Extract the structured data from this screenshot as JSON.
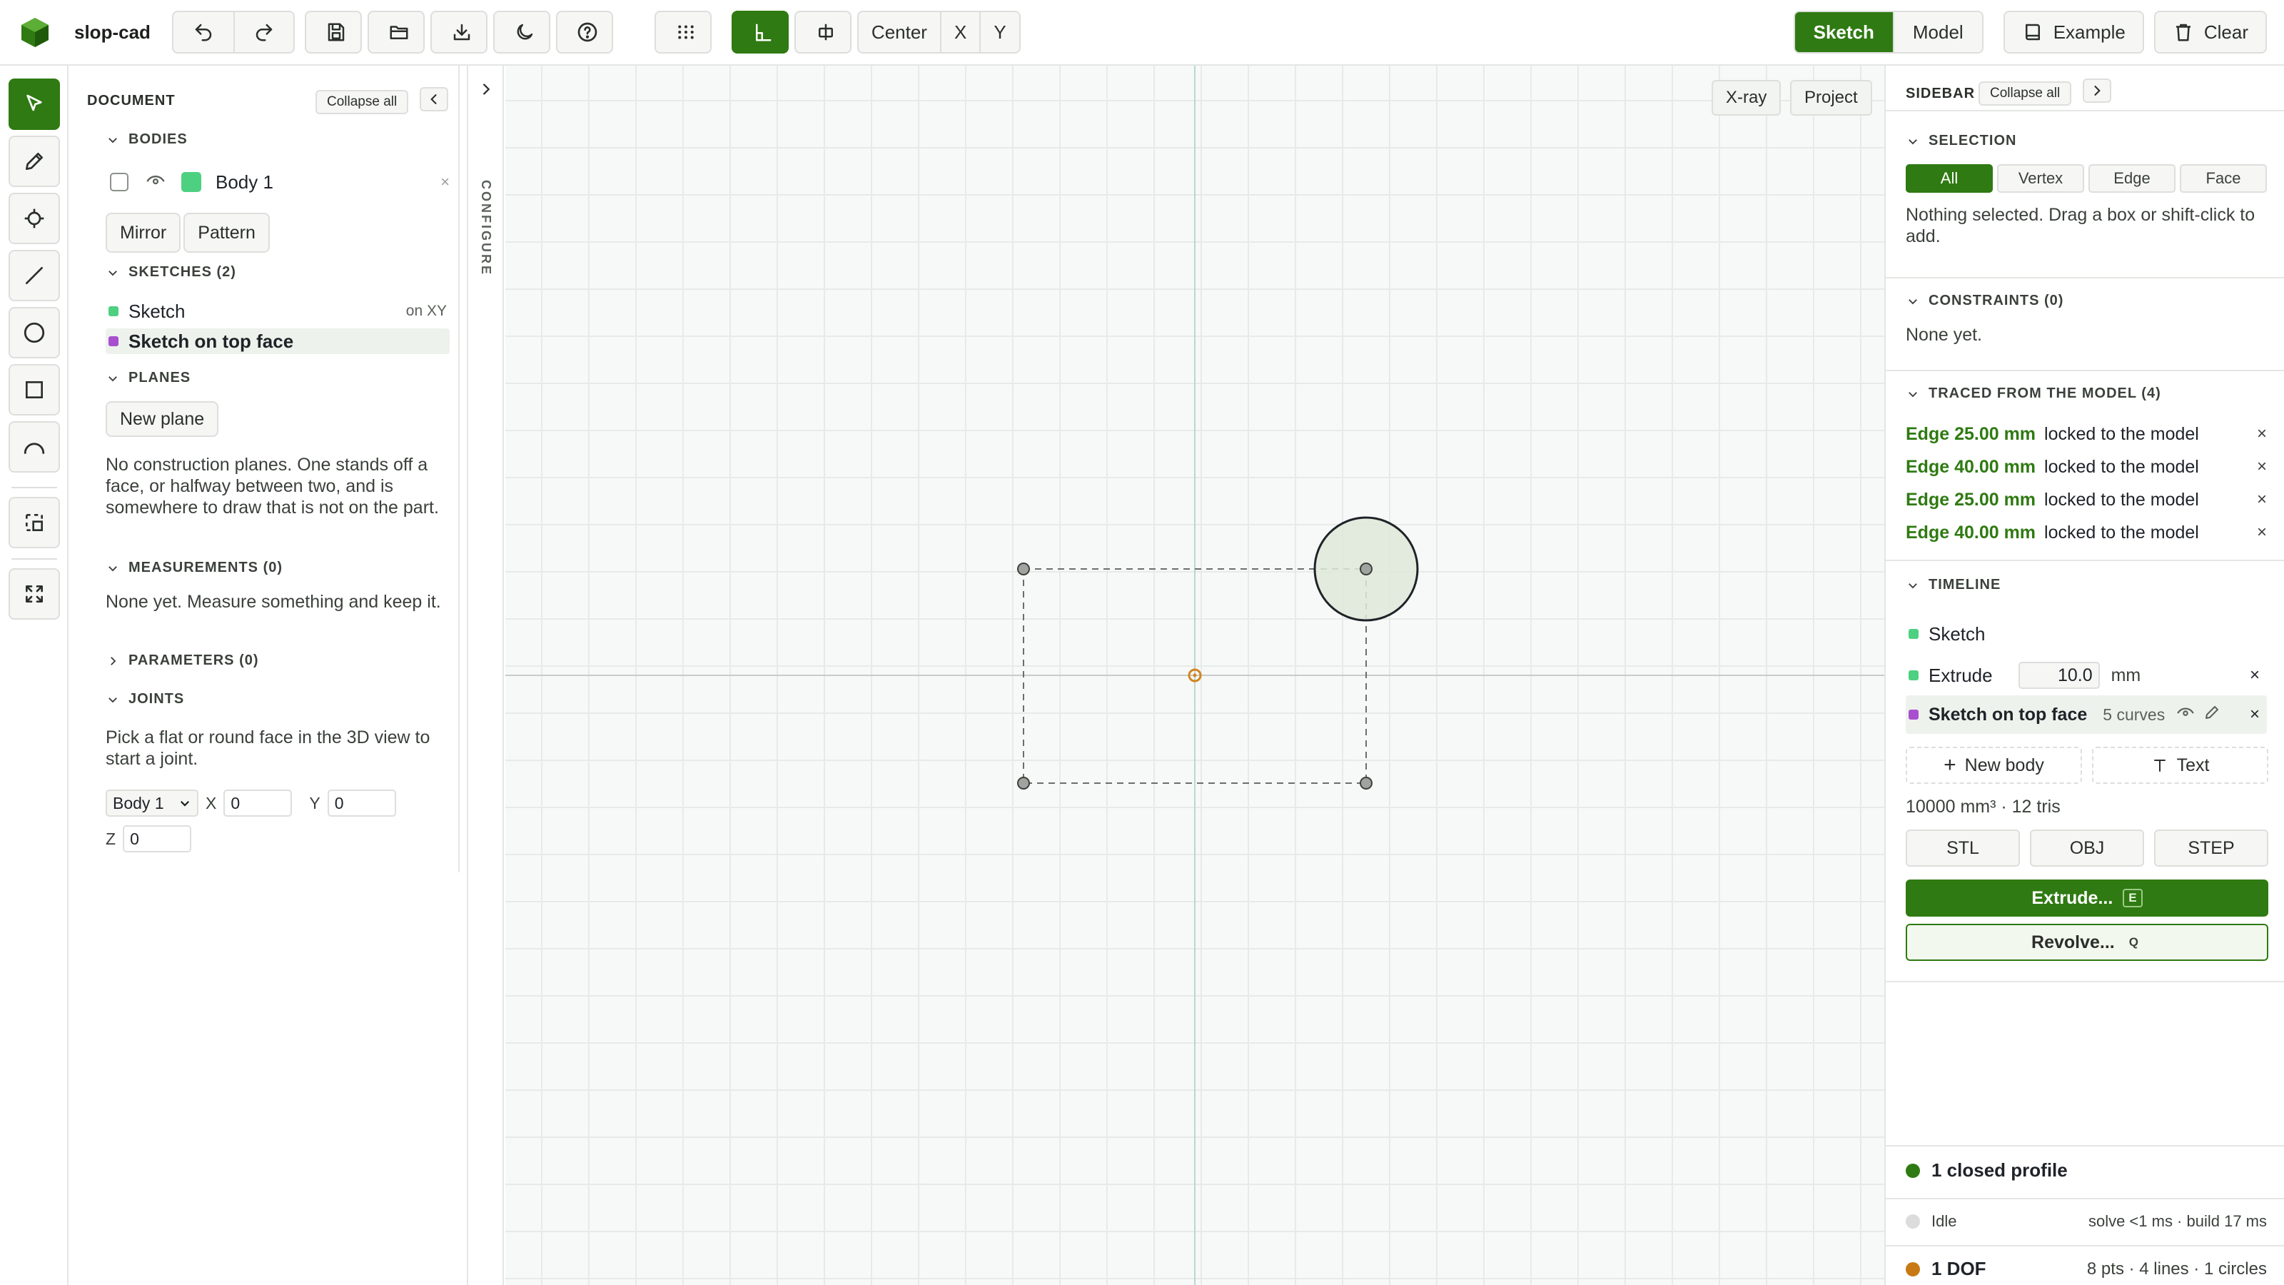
{
  "app": {
    "name": "slop-cad"
  },
  "toolbar": {
    "center_label": "Center",
    "x_label": "X",
    "y_label": "Y",
    "sketch_label": "Sketch",
    "model_label": "Model",
    "example_label": "Example",
    "clear_label": "Clear"
  },
  "document": {
    "title": "DOCUMENT",
    "collapse_all": "Collapse all",
    "bodies_header": "BODIES",
    "bodies": [
      {
        "name": "Body 1",
        "color": "#4ed081"
      }
    ],
    "mirror_label": "Mirror",
    "pattern_label": "Pattern",
    "sketches_header": "SKETCHES (2)",
    "sketches": [
      {
        "name": "Sketch",
        "plane": "on XY",
        "color": "#4ed081"
      },
      {
        "name": "Sketch on top face",
        "plane": "",
        "color": "#a84fd0"
      }
    ],
    "planes_header": "PLANES",
    "new_plane_label": "New plane",
    "planes_text": "No construction planes. One stands off a face, or halfway between two, and is somewhere to draw that is not on the part.",
    "measurements_header": "MEASUREMENTS (0)",
    "measurements_text": "None yet. Measure something and keep it.",
    "parameters_header": "PARAMETERS (0)",
    "joints_header": "JOINTS",
    "joints_text": "Pick a flat or round face in the 3D view to start a joint.",
    "joint_body": "Body 1",
    "joint_x_label": "X",
    "joint_x": "0",
    "joint_y_label": "Y",
    "joint_y": "0",
    "joint_z_label": "Z",
    "joint_z": "0"
  },
  "configure_label": "CONFIGURE",
  "viewport": {
    "xray_label": "X-ray",
    "project_label": "Project"
  },
  "sidebar": {
    "title": "SIDEBAR",
    "collapse_all": "Collapse all",
    "selection_header": "SELECTION",
    "selection_modes": [
      "All",
      "Vertex",
      "Edge",
      "Face"
    ],
    "selected_mode": "All",
    "selection_text": "Nothing selected. Drag a box or shift-click to add.",
    "constraints_header": "CONSTRAINTS (0)",
    "constraints_text": "None yet.",
    "traced_header": "TRACED FROM THE MODEL (4)",
    "traced": [
      {
        "edge": "Edge 25.00 mm",
        "status": "locked to the model",
        "remove": "×"
      },
      {
        "edge": "Edge 40.00 mm",
        "status": "locked to the model",
        "remove": "×"
      },
      {
        "edge": "Edge 25.00 mm",
        "status": "locked to the model",
        "remove": "×"
      },
      {
        "edge": "Edge 40.00 mm",
        "status": "locked to the model",
        "remove": "×"
      }
    ],
    "timeline_header": "TIMELINE",
    "timeline": {
      "sketch": {
        "name": "Sketch",
        "color": "#4ed081"
      },
      "extrude": {
        "name": "Extrude",
        "value": "10.0",
        "unit": "mm",
        "remove": "×",
        "color": "#4ed081"
      },
      "top_sketch": {
        "name": "Sketch on top face",
        "curves": "5 curves",
        "remove": "×",
        "color": "#a84fd0"
      }
    },
    "new_body_label": "New body",
    "text_label": "Text",
    "stats": "10000 mm³ · 12 tris",
    "export": [
      "STL",
      "OBJ",
      "STEP"
    ],
    "extrude_label": "Extrude...",
    "extrude_key": "E",
    "revolve_label": "Revolve...",
    "revolve_key": "Q",
    "status": {
      "profile": "1 closed profile",
      "idle": "Idle",
      "timing": "solve <1 ms · build 17 ms",
      "dof": "1 DOF",
      "counts": "8 pts · 4 lines · 1 circles"
    }
  },
  "colors": {
    "accent": "#2f7a12",
    "profile_ok": "#2f7a12",
    "idle": "#dcdcdc",
    "dof_warning": "#c77a14"
  }
}
